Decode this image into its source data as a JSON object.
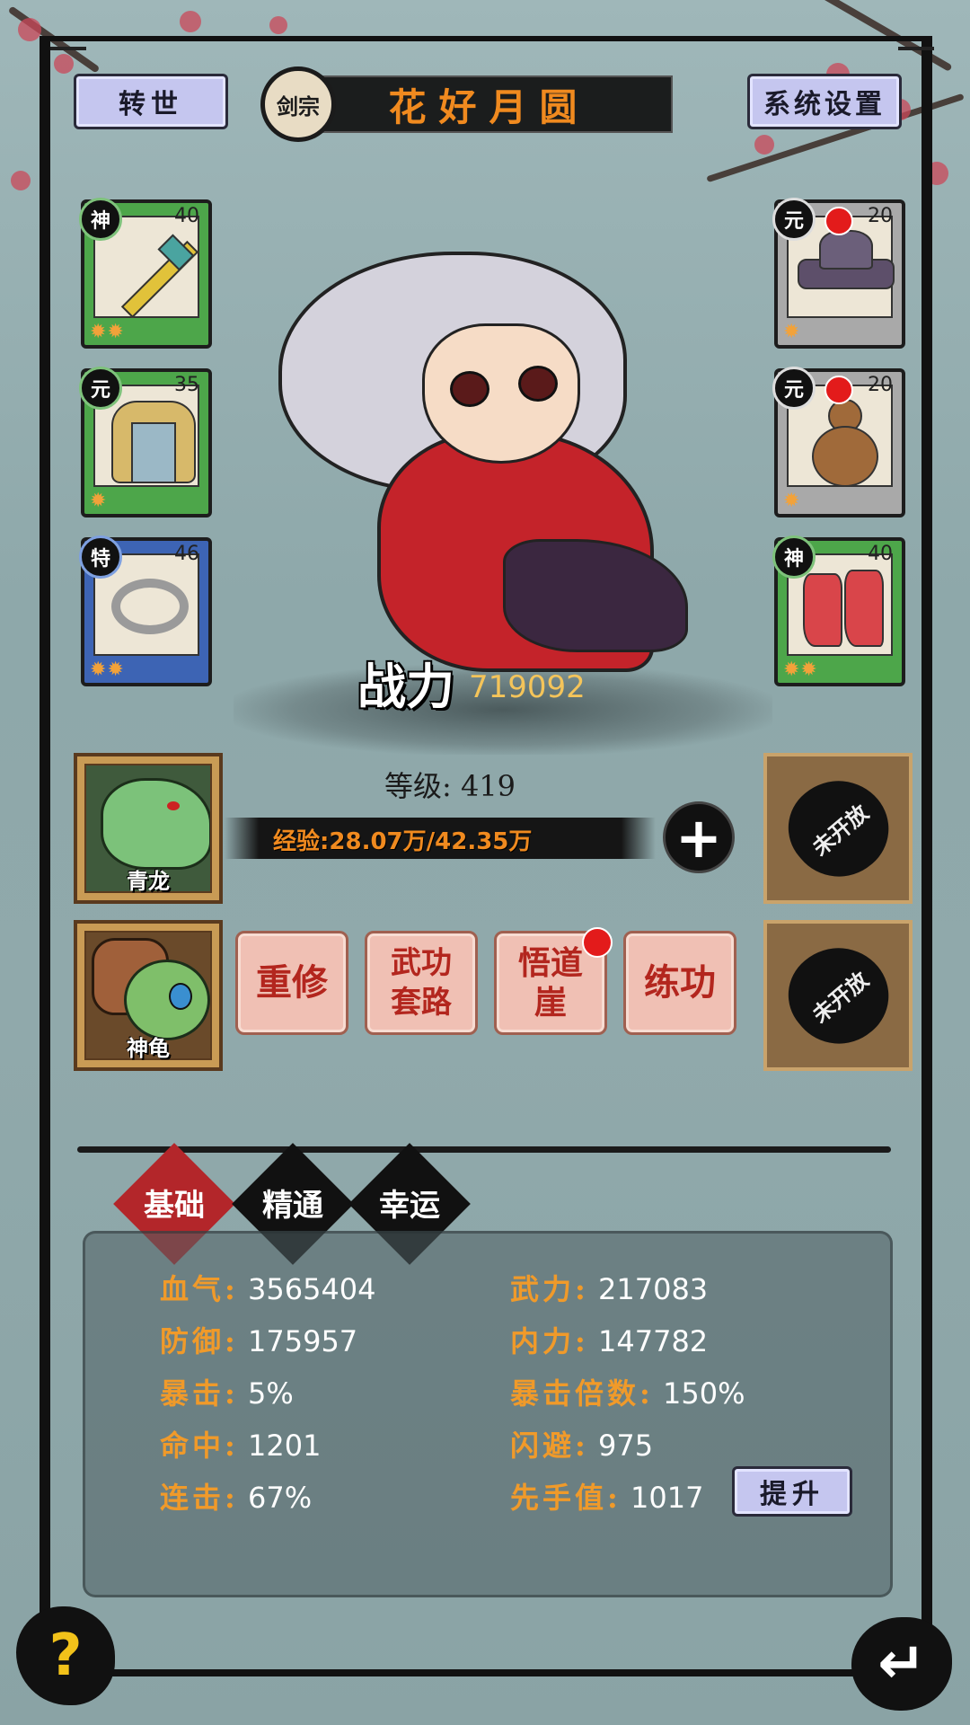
{
  "header": {
    "rebirth_label": "转世",
    "sect_label": "剑宗",
    "character_name": "花好月圆",
    "settings_label": "系统设置"
  },
  "equipment_left": [
    {
      "grade": "神",
      "level": "40",
      "stars": "✹✹",
      "item": "sword"
    },
    {
      "grade": "元",
      "level": "35",
      "stars": "✹",
      "item": "armor"
    },
    {
      "grade": "特",
      "level": "46",
      "stars": "✹✹",
      "item": "ring"
    }
  ],
  "equipment_right": [
    {
      "grade": "元",
      "level": "20",
      "stars": "✹",
      "item": "hat"
    },
    {
      "grade": "元",
      "level": "20",
      "stars": "✹",
      "item": "gourd"
    },
    {
      "grade": "神",
      "level": "40",
      "stars": "✹✹",
      "item": "boots"
    }
  ],
  "combat": {
    "power_label": "战力",
    "power_value": "719092"
  },
  "level": {
    "text": "等级: 419",
    "exp_text": "经验:28.07万/42.35万",
    "plus": "+"
  },
  "pets": [
    {
      "name": "青龙"
    },
    {
      "name": "神龟"
    }
  ],
  "locked": {
    "label": "未开放"
  },
  "actions": [
    {
      "label": "重修"
    },
    {
      "label": "武功套路"
    },
    {
      "label": "悟道崖"
    },
    {
      "label": "练功"
    }
  ],
  "tabs": [
    {
      "label": "基础",
      "active": true
    },
    {
      "label": "精通",
      "active": false
    },
    {
      "label": "幸运",
      "active": false
    }
  ],
  "stats": {
    "hp": {
      "label": "血气:",
      "value": "3565404"
    },
    "attack": {
      "label": "武力:",
      "value": "217083"
    },
    "defense": {
      "label": "防御:",
      "value": "175957"
    },
    "inner": {
      "label": "内力:",
      "value": "147782"
    },
    "crit": {
      "label": "暴击:",
      "value": "5%"
    },
    "crit_mult": {
      "label": "暴击倍数:",
      "value": "150%"
    },
    "hit": {
      "label": "命中:",
      "value": "1201"
    },
    "dodge": {
      "label": "闪避:",
      "value": "975"
    },
    "combo": {
      "label": "连击:",
      "value": "67%"
    },
    "initiative": {
      "label": "先手值:",
      "value": "1017"
    }
  },
  "upgrade_label": "提升",
  "help_label": "?",
  "back_label": "↵",
  "colors": {
    "accent_orange": "#f08a1f",
    "stat_label": "#f09a2a",
    "active_tab": "#b3262a",
    "power_value": "#f4c45a"
  }
}
